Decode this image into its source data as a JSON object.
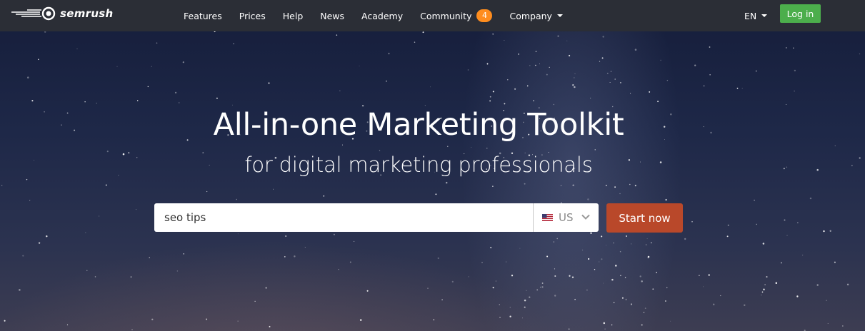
{
  "header": {
    "logo_text": "semrush",
    "nav": [
      {
        "label": "Features"
      },
      {
        "label": "Prices"
      },
      {
        "label": "Help"
      },
      {
        "label": "News"
      },
      {
        "label": "Academy"
      },
      {
        "label": "Community",
        "badge": "4"
      },
      {
        "label": "Company"
      }
    ],
    "language": "EN",
    "login_label": "Log in"
  },
  "hero": {
    "title": "All-in-one Marketing Toolkit",
    "subtitle": "for digital marketing professionals"
  },
  "search": {
    "value": "seo tips",
    "database": "US",
    "submit_label": "Start now"
  },
  "colors": {
    "header_bg": "#2b2e36",
    "login_green": "#4cae4c",
    "badge_orange": "#ff8d1e",
    "cta_red": "#b9482a"
  },
  "icons": [
    "semrush-logo-icon",
    "us-flag-icon",
    "chevron-down-icon",
    "caret-down-icon"
  ]
}
